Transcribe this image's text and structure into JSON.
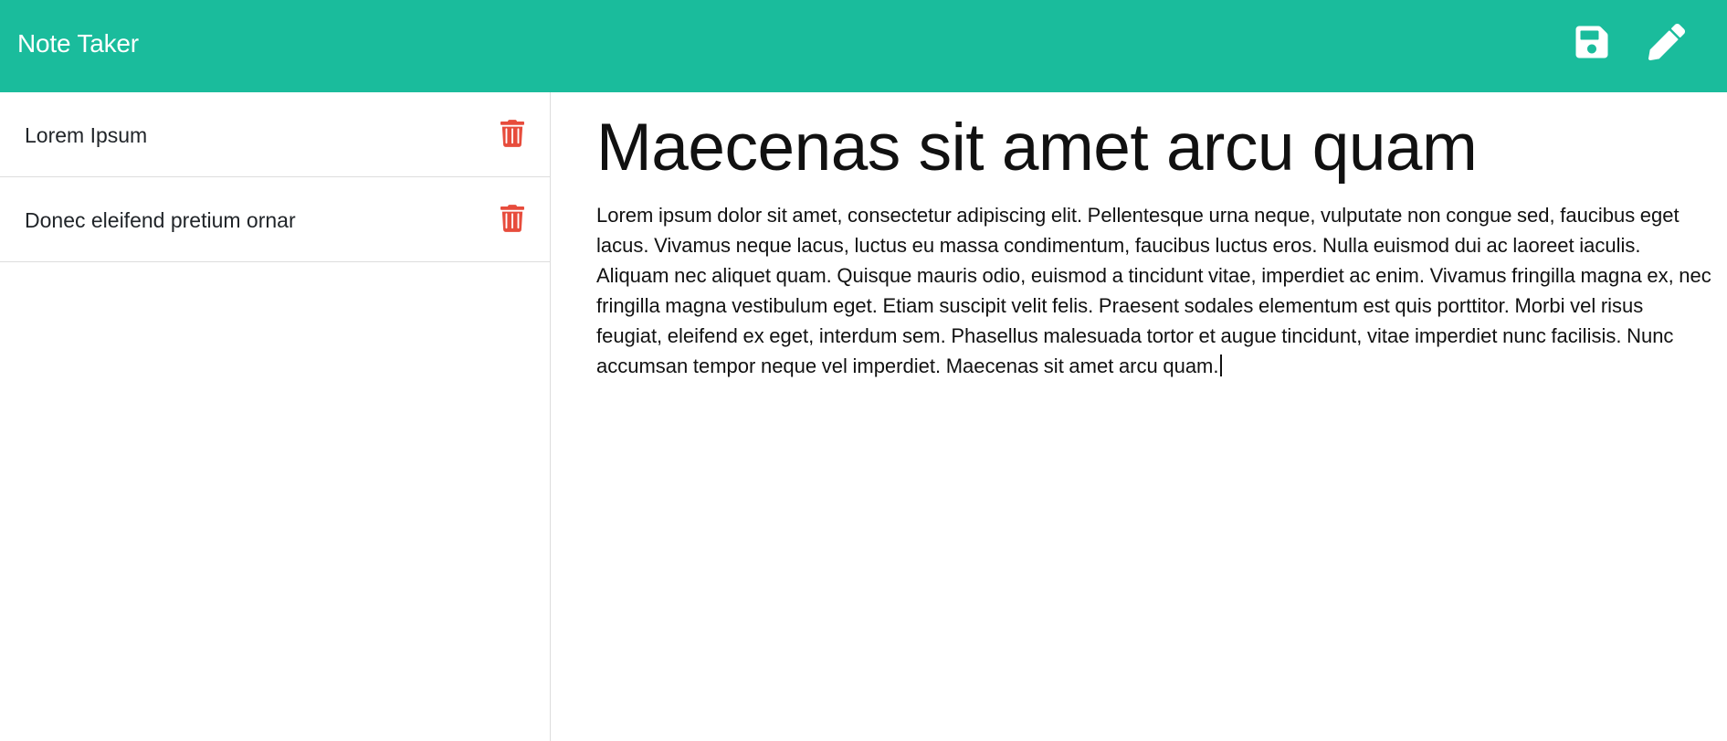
{
  "app": {
    "title": "Note Taker"
  },
  "toolbar": {
    "save_icon": "save-icon",
    "write_icon": "pencil-icon"
  },
  "sidebar": {
    "notes": [
      {
        "title": "Lorem Ipsum",
        "delete_icon": "trash-icon"
      },
      {
        "title": "Donec eleifend pretium ornar",
        "delete_icon": "trash-icon"
      }
    ]
  },
  "editor": {
    "note_title": "Maecenas sit amet arcu quam",
    "note_text": "Lorem ipsum dolor sit amet, consectetur adipiscing elit. Pellentesque urna neque, vulputate non congue sed, faucibus eget lacus. Vivamus neque lacus, luctus eu massa condimentum, faucibus luctus eros. Nulla euismod dui ac laoreet iaculis. Aliquam nec aliquet quam. Quisque mauris odio, euismod a tincidunt vitae, imperdiet ac enim. Vivamus fringilla magna ex, nec fringilla magna vestibulum eget. Etiam suscipit velit felis. Praesent sodales elementum est quis porttitor. Morbi vel risus feugiat, eleifend ex eget, interdum sem. Phasellus malesuada tortor et augue tincidunt, vitae imperdiet nunc facilisis. Nunc accumsan tempor neque vel imperdiet. Maecenas sit amet arcu quam."
  },
  "colors": {
    "navbar": "#1abc9c",
    "delete_icon": "#e74c3c",
    "nav_icon": "#ffffff"
  }
}
